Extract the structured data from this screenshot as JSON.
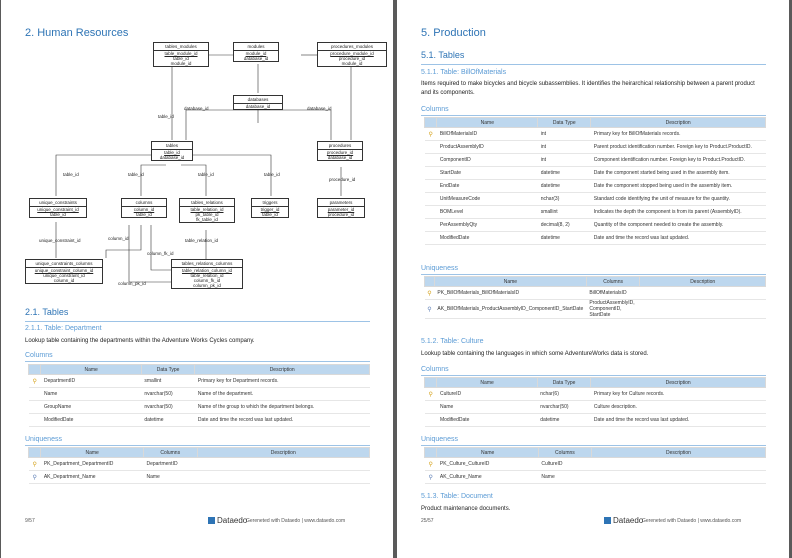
{
  "page1": {
    "heading": "2.   Human Resources",
    "diagram": {
      "entities": {
        "tables_modules": {
          "name": "tables_modules",
          "cols": [
            "table_module_id",
            "table_id",
            "module_id"
          ]
        },
        "modules": {
          "name": "modules",
          "cols": [
            "module_id",
            "database_id"
          ]
        },
        "procedures_modules": {
          "name": "procedures_modules",
          "cols": [
            "procedure_module_id",
            "procedure_id",
            "module_id"
          ]
        },
        "databases": {
          "name": "databases",
          "cols": [
            "database_id"
          ]
        },
        "tables": {
          "name": "tables",
          "cols": [
            "table_id",
            "database_id"
          ]
        },
        "procedures": {
          "name": "procedures",
          "cols": [
            "procedure_id",
            "database_id"
          ]
        },
        "unique_constraints": {
          "name": "unique_constraints",
          "cols": [
            "unique_constraint_id",
            "table_id"
          ]
        },
        "columns": {
          "name": "columns",
          "cols": [
            "column_id",
            "table_id"
          ]
        },
        "tables_relations": {
          "name": "tables_relations",
          "cols": [
            "table_relation_id",
            "pk_table_id",
            "fk_table_id"
          ]
        },
        "triggers": {
          "name": "triggers",
          "cols": [
            "trigger_id",
            "table_id"
          ]
        },
        "parameters": {
          "name": "parameters",
          "cols": [
            "parameter_id",
            "procedure_id"
          ]
        },
        "unique_constraints_columns": {
          "name": "unique_constraints_columns",
          "cols": [
            "unique_constraint_column_id",
            "unique_constraint_id",
            "column_id"
          ]
        },
        "tables_relations_columns": {
          "name": "tables_relations_columns",
          "cols": [
            "table_relation_column_id",
            "table_relation_id",
            "column_fk_id",
            "column_pk_id"
          ]
        }
      },
      "labels": [
        "table_id",
        "database_id",
        "database_id",
        "table_id",
        "table_id",
        "table_id",
        "table_id",
        "procedure_id",
        "unique_constraint_id",
        "column_id",
        "column_fk_id",
        "table_relation_id",
        "column_pk_id"
      ]
    },
    "section_tables": "2.1.  Tables",
    "table_heading": "2.1.1.   Table: Department",
    "table_desc": "Lookup table containing the departments within the Adventure Works Cycles company.",
    "columns_heading": "Columns",
    "columns_headers": [
      "Name",
      "Data Type",
      "Description"
    ],
    "columns_rows": [
      {
        "key": "pk",
        "name": "DepartmentID",
        "type": "smallint",
        "desc": "Primary key for Department records."
      },
      {
        "key": "",
        "name": "Name",
        "type": "nvarchar(50)",
        "desc": "Name of the department."
      },
      {
        "key": "",
        "name": "GroupName",
        "type": "nvarchar(50)",
        "desc": "Name of the group to which the department belongs."
      },
      {
        "key": "",
        "name": "ModifiedDate",
        "type": "datetime",
        "desc": "Date and time the record was last updated."
      }
    ],
    "uniqueness_heading": "Uniqueness",
    "uniq_headers": [
      "Name",
      "Columns",
      "Description"
    ],
    "uniq_rows": [
      {
        "key": "pk",
        "name": "PK_Department_DepartmentID",
        "cols": "DepartmentID",
        "desc": ""
      },
      {
        "key": "uk",
        "name": "AK_Department_Name",
        "cols": "Name",
        "desc": ""
      }
    ],
    "page_number": "9/57",
    "logo": "Dataedo",
    "generated": "Gereneted with Dataedo | www.dataedo.com"
  },
  "page2": {
    "heading": "5.   Production",
    "section_tables": "5.1.  Tables",
    "t1_heading": "5.1.1.   Table: BillOfMaterials",
    "t1_desc": "Items required to make bicycles and bicycle subassemblies. It identifies the heirarchical relationship between a parent product and its components.",
    "columns_heading": "Columns",
    "columns_headers": [
      "Name",
      "Data Type",
      "Description"
    ],
    "t1_rows": [
      {
        "key": "pk",
        "name": "BillOfMaterialsID",
        "type": "int",
        "desc": "Primary key for BillOfMaterials records."
      },
      {
        "key": "",
        "name": "ProductAssemblyID",
        "type": "int",
        "desc": "Parent product identification number. Foreign key to Product.ProductID."
      },
      {
        "key": "",
        "name": "ComponentID",
        "type": "int",
        "desc": "Component identification number. Foreign key to Product.ProductID."
      },
      {
        "key": "",
        "name": "StartDate",
        "type": "datetime",
        "desc": "Date the component started being used in the assembly item."
      },
      {
        "key": "",
        "name": "EndDate",
        "type": "datetime",
        "desc": "Date the component stopped being used in the assembly item."
      },
      {
        "key": "",
        "name": "UnitMeasureCode",
        "type": "nchar(3)",
        "desc": "Standard code identifying the unit of measure for the quantity."
      },
      {
        "key": "",
        "name": "BOMLevel",
        "type": "smallint",
        "desc": "Indicates the depth the component is from its parent (AssemblyID)."
      },
      {
        "key": "",
        "name": "PerAssemblyQty",
        "type": "decimal(8, 2)",
        "desc": "Quantity of the component needed to create the assembly."
      },
      {
        "key": "",
        "name": "ModifiedDate",
        "type": "datetime",
        "desc": "Date and time the record was last updated."
      }
    ],
    "uniqueness_heading": "Uniqueness",
    "uniq_headers": [
      "Name",
      "Columns",
      "Description"
    ],
    "t1_uniq": [
      {
        "key": "pk",
        "name": "PK_BillOfMaterials_BillOfMaterialsID",
        "cols": "BillOfMaterialsID",
        "desc": ""
      },
      {
        "key": "uk",
        "name": "AK_BillOfMaterials_ProductAssemblyID_ComponentID_StartDate",
        "cols": "ProductAssemblyID, ComponentID, StartDate",
        "desc": ""
      }
    ],
    "t2_heading": "5.1.2.   Table: Culture",
    "t2_desc": "Lookup table containing the languages in which some AdventureWorks data is stored.",
    "t2_rows": [
      {
        "key": "pk",
        "name": "CultureID",
        "type": "nchar(6)",
        "desc": "Primary key for Culture records."
      },
      {
        "key": "",
        "name": "Name",
        "type": "nvarchar(50)",
        "desc": "Culture description."
      },
      {
        "key": "",
        "name": "ModifiedDate",
        "type": "datetime",
        "desc": "Date and time the record was last updated."
      }
    ],
    "t2_uniq": [
      {
        "key": "pk",
        "name": "PK_Culture_CultureID",
        "cols": "CultureID",
        "desc": ""
      },
      {
        "key": "uk",
        "name": "AK_Culture_Name",
        "cols": "Name",
        "desc": ""
      }
    ],
    "t3_heading": "5.1.3.   Table: Document",
    "t3_desc": "Product maintenance documents.",
    "page_number": "25/57",
    "logo": "Dataedo",
    "generated": "Gereneted with Dataedo | www.dataedo.com"
  },
  "colors": {
    "accent": "#2e74b5",
    "table_header": "#bdd7ee",
    "pk_key": "#d4a017",
    "uk_key": "#5b7db5"
  },
  "icons": {
    "pk": "key-icon",
    "uk": "unique-key-icon",
    "logo": "dataedo-logo-icon"
  }
}
